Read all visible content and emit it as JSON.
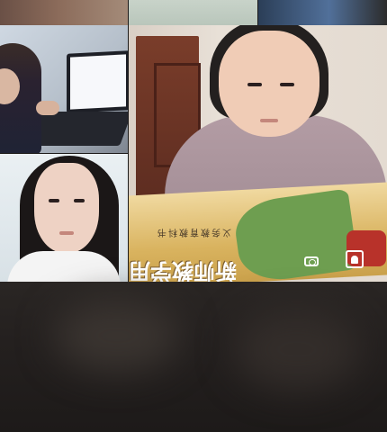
{
  "grid": {
    "tiles": [
      {
        "id": "top-left",
        "kind": "partial-video"
      },
      {
        "id": "top-mid",
        "kind": "partial-video"
      },
      {
        "id": "top-right",
        "kind": "partial-video"
      },
      {
        "id": "laptop",
        "kind": "video",
        "subject": "person-at-laptop"
      },
      {
        "id": "selfie",
        "kind": "video",
        "subject": "person-face"
      },
      {
        "id": "main",
        "kind": "video",
        "subject": "person-reading-book"
      }
    ]
  },
  "main_tile": {
    "book_text_small": "义务教育教科书",
    "book_text_big": "新师教学用",
    "controls": {
      "switch_camera_icon": "camera-switch-icon",
      "pip_icon": "picture-in-picture-icon"
    }
  },
  "colors": {
    "background": "#1c1a19",
    "overlay_icon": "#ffffff"
  }
}
